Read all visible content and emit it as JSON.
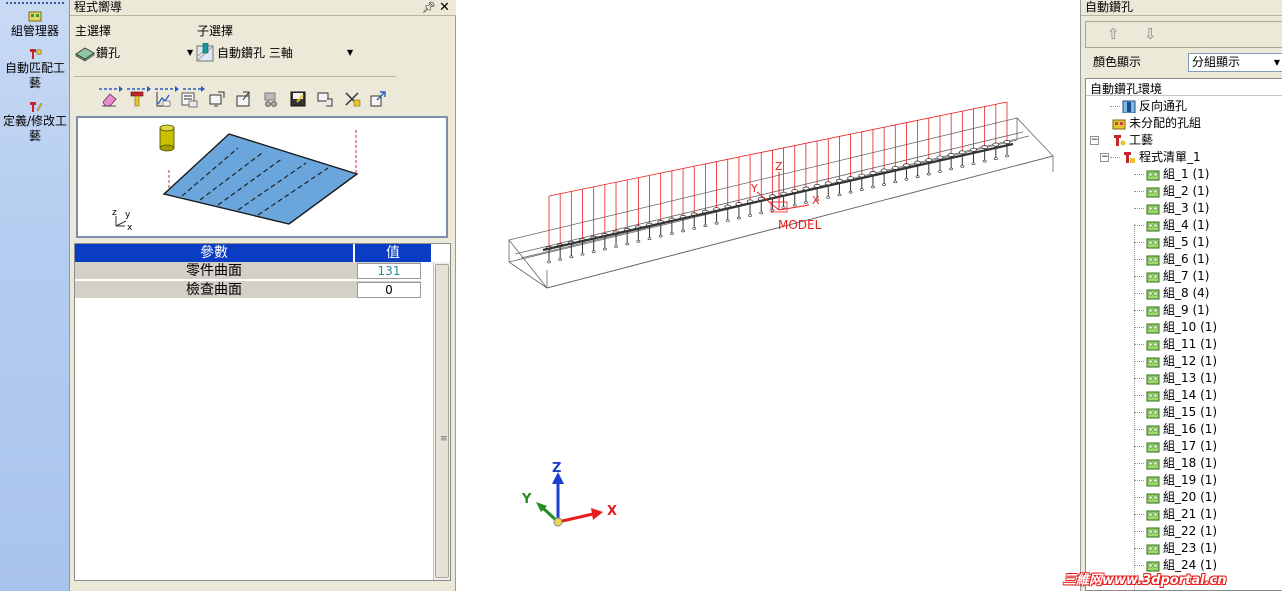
{
  "left_toolbar": {
    "items": [
      {
        "label": "組管理器",
        "icon": "group-manager-icon"
      },
      {
        "label": "自動匹配工藝",
        "icon": "auto-match-process-icon"
      },
      {
        "label": "定義/修改工藝",
        "icon": "define-process-icon"
      }
    ]
  },
  "wizard": {
    "title": "程式嚮導",
    "pin_icon": "pin-icon",
    "close_icon": "close-icon",
    "main_select_label": "主選擇",
    "main_select_value": "鑽孔",
    "sub_select_label": "子選擇",
    "sub_select_value": "自動鑽孔 三軸",
    "toolbar_icons": [
      "eraser-icon",
      "hammer-icon",
      "graph-icon",
      "list-icon",
      "monitor-icon",
      "export-icon",
      "machine-icon",
      "save-icon",
      "move-icon",
      "tools-icon",
      "resize-icon"
    ],
    "preview": {
      "axis_labels": {
        "z": "z",
        "y": "y",
        "x": "x"
      }
    },
    "params": {
      "header_param": "參數",
      "header_value": "值",
      "rows": [
        {
          "name": "零件曲面",
          "value": "131"
        },
        {
          "name": "檢查曲面",
          "value": "0"
        }
      ]
    }
  },
  "viewport": {
    "model_label": "MODEL",
    "local_axes": {
      "z": "Z",
      "y": "Y",
      "x": "X"
    },
    "triad": {
      "z": "Z",
      "y": "Y",
      "x": "X"
    },
    "colors": {
      "axis_x": "#e81e1e",
      "axis_y": "#1f8f1f",
      "axis_z": "#1f3fd0",
      "hole_lines": "#e81e1e"
    }
  },
  "right_panel": {
    "title": "自動鑽孔",
    "up_arrow": "arrow-up-icon",
    "down_arrow": "arrow-down-icon",
    "color_label": "顏色顯示",
    "color_value": "分組顯示",
    "tree": [
      {
        "label": "自動鑽孔環境",
        "level": 0,
        "icon": ""
      },
      {
        "label": "反向通孔",
        "level": 2,
        "icon": "reverse-hole-icon"
      },
      {
        "label": "未分配的孔組",
        "level": 1,
        "icon": "unassigned-icon"
      },
      {
        "label": "工藝",
        "level": 1,
        "icon": "process-icon",
        "expander": "−"
      },
      {
        "label": "程式清單_1",
        "level": 2,
        "icon": "program-icon",
        "expander": "−"
      },
      {
        "label": "組_1 (1)",
        "level": 3,
        "icon": "group-icon"
      },
      {
        "label": "組_2 (1)",
        "level": 3,
        "icon": "group-icon"
      },
      {
        "label": "組_3 (1)",
        "level": 3,
        "icon": "group-icon"
      },
      {
        "label": "組_4 (1)",
        "level": 3,
        "icon": "group-icon"
      },
      {
        "label": "組_5 (1)",
        "level": 3,
        "icon": "group-icon"
      },
      {
        "label": "組_6 (1)",
        "level": 3,
        "icon": "group-icon"
      },
      {
        "label": "組_7 (1)",
        "level": 3,
        "icon": "group-icon"
      },
      {
        "label": "組_8 (4)",
        "level": 3,
        "icon": "group-icon"
      },
      {
        "label": "組_9 (1)",
        "level": 3,
        "icon": "group-icon"
      },
      {
        "label": "組_10 (1)",
        "level": 3,
        "icon": "group-icon"
      },
      {
        "label": "組_11 (1)",
        "level": 3,
        "icon": "group-icon"
      },
      {
        "label": "組_12 (1)",
        "level": 3,
        "icon": "group-icon"
      },
      {
        "label": "組_13 (1)",
        "level": 3,
        "icon": "group-icon"
      },
      {
        "label": "組_14 (1)",
        "level": 3,
        "icon": "group-icon"
      },
      {
        "label": "組_15 (1)",
        "level": 3,
        "icon": "group-icon"
      },
      {
        "label": "組_16 (1)",
        "level": 3,
        "icon": "group-icon"
      },
      {
        "label": "組_17 (1)",
        "level": 3,
        "icon": "group-icon"
      },
      {
        "label": "組_18 (1)",
        "level": 3,
        "icon": "group-icon"
      },
      {
        "label": "組_19 (1)",
        "level": 3,
        "icon": "group-icon"
      },
      {
        "label": "組_20 (1)",
        "level": 3,
        "icon": "group-icon"
      },
      {
        "label": "組_21 (1)",
        "level": 3,
        "icon": "group-icon"
      },
      {
        "label": "組_22 (1)",
        "level": 3,
        "icon": "group-icon"
      },
      {
        "label": "組_23 (1)",
        "level": 3,
        "icon": "group-icon"
      },
      {
        "label": "組_24 (1)",
        "level": 3,
        "icon": "group-icon"
      }
    ]
  },
  "watermark": "三維网www.3dportal.cn"
}
